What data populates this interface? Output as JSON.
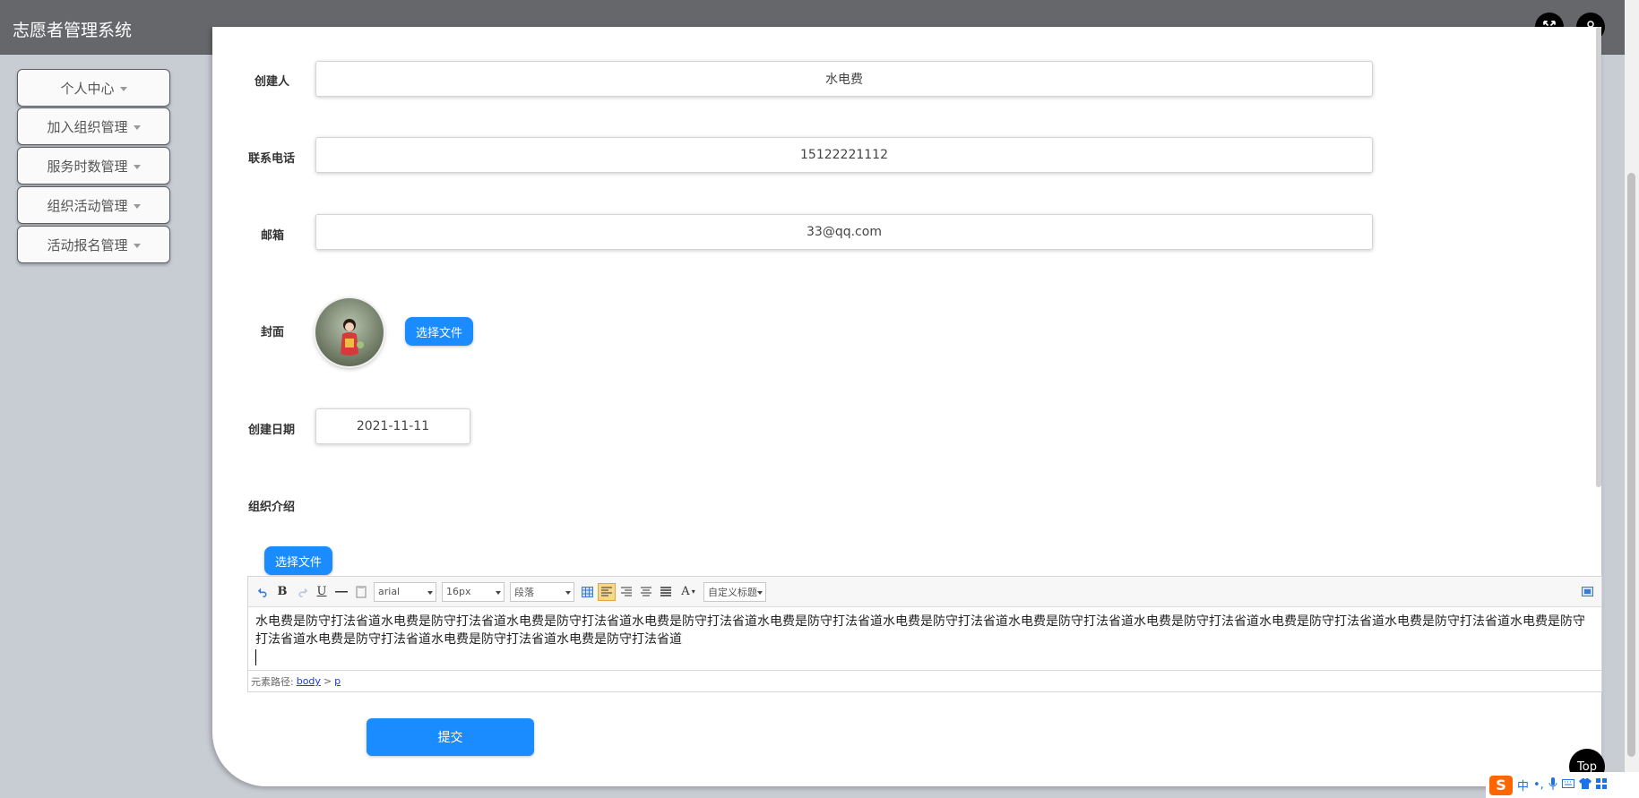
{
  "app": {
    "title": "志愿者管理系统"
  },
  "sidebar": {
    "items": [
      {
        "label": "个人中心"
      },
      {
        "label": "加入组织管理"
      },
      {
        "label": "服务时数管理"
      },
      {
        "label": "组织活动管理"
      },
      {
        "label": "活动报名管理"
      }
    ]
  },
  "form": {
    "creator": {
      "label": "创建人",
      "value": "水电费"
    },
    "phone": {
      "label": "联系电话",
      "value": "15122221112"
    },
    "email": {
      "label": "邮箱",
      "value": "33@qq.com"
    },
    "cover": {
      "label": "封面",
      "button": "选择文件"
    },
    "date": {
      "label": "创建日期",
      "value": "2021-11-11"
    },
    "intro": {
      "label": "组织介绍",
      "button": "选择文件"
    },
    "submit": "提交"
  },
  "editor": {
    "font_family": "arial",
    "font_size": "16px",
    "paragraph": "段落",
    "custom_title": "自定义标题",
    "content": "水电费是防守打法省道水电费是防守打法省道水电费是防守打法省道水电费是防守打法省道水电费是防守打法省道水电费是防守打法省道水电费是防守打法省道水电费是防守打法省道水电费是防守打法省道水电费是防守打法省道水电费是防守打法省道水电费是防守打法省道水电费是防守打法省道水电费是防守打法省道",
    "path_label": "元素路径:",
    "path_body": "body",
    "path_sep": ">",
    "path_p": "p"
  },
  "float": {
    "top_label": "Top"
  },
  "ime": {
    "lang": "中"
  }
}
